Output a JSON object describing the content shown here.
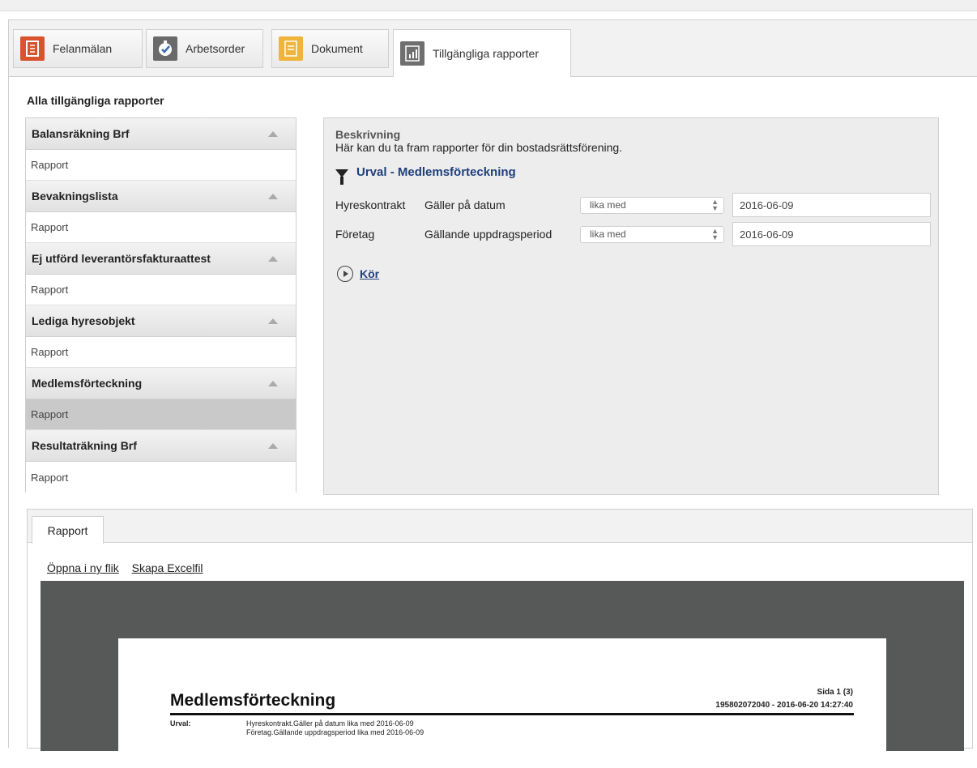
{
  "tabs": [
    {
      "label": "Felanmälan",
      "icon": "report-form-icon"
    },
    {
      "label": "Arbetsorder",
      "icon": "stopwatch-check-icon"
    },
    {
      "label": "Dokument",
      "icon": "document-icon"
    },
    {
      "label": "Tillgängliga rapporter",
      "icon": "bar-chart-report-icon",
      "active": true
    }
  ],
  "section_title": "Alla tillgängliga rapporter",
  "report_groups": [
    {
      "title": "Balansräkning Brf",
      "item": "Rapport"
    },
    {
      "title": "Bevakningslista",
      "item": "Rapport"
    },
    {
      "title": "Ej utförd leverantörsfakturaattest",
      "item": "Rapport"
    },
    {
      "title": "Lediga hyresobjekt",
      "item": "Rapport"
    },
    {
      "title": "Medlemsförteckning",
      "item": "Rapport",
      "selected": true
    },
    {
      "title": "Resultaträkning Brf",
      "item": "Rapport"
    }
  ],
  "description": {
    "title": "Beskrivning",
    "text": "Här kan du ta fram rapporter för din bostadsrättsförening."
  },
  "urval": {
    "title": "Urval - Medlemsförteckning",
    "filters": [
      {
        "entity": "Hyreskontrakt",
        "field": "Gäller på datum",
        "operator": "lika med",
        "value": "2016-06-09"
      },
      {
        "entity": "Företag",
        "field": "Gällande uppdragsperiod",
        "operator": "lika med",
        "value": "2016-06-09"
      }
    ],
    "run_label": "Kör"
  },
  "report_view": {
    "tab_label": "Rapport",
    "link_open": "Öppna i ny flik",
    "link_excel": "Skapa Excelfil",
    "doc": {
      "title": "Medlemsförteckning",
      "page": "Sida 1 (3)",
      "id_line": "195802072040 - 2016-06-20 14:27:40",
      "urval_label": "Urval:",
      "urval_lines": [
        "Hyreskontrakt.Gäller på datum lika med 2016-06-09",
        "Företag.Gällande uppdragsperiod lika med 2016-06-09"
      ]
    }
  },
  "colors": {
    "accent_link": "#1f3f7a",
    "felanmalan_icon": "#d9532c",
    "dokument_icon": "#f0b43a",
    "viewer_bg": "#575959",
    "selected_row": "#c9c9c9"
  }
}
